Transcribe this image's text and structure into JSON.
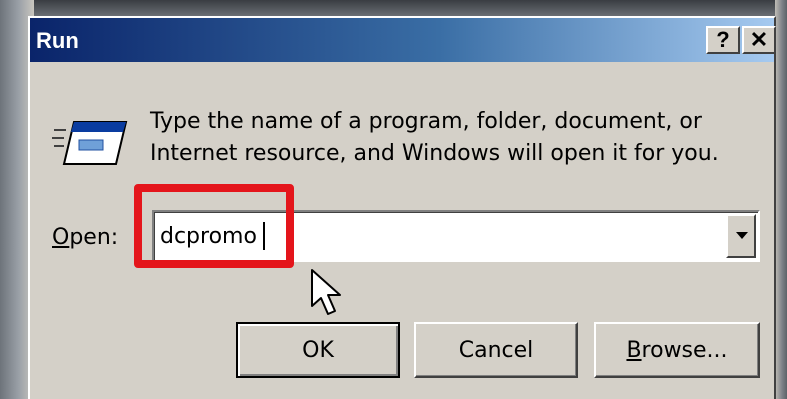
{
  "window": {
    "title": "Run",
    "help_label": "?",
    "close_label": "✕"
  },
  "description": {
    "line1": "Type the name of a program, folder, document, or",
    "line2": "Internet resource, and Windows will open it for you."
  },
  "open": {
    "label_accel": "O",
    "label_rest": "pen:",
    "value": "dcpromo"
  },
  "buttons": {
    "ok": "OK",
    "cancel": "Cancel",
    "browse_accel": "B",
    "browse_rest": "rowse..."
  },
  "icons": {
    "run": "run-program-icon",
    "cursor": "mouse-pointer-icon",
    "dropdown": "chevron-down-icon"
  },
  "colors": {
    "titlebar_start": "#0a246a",
    "titlebar_end": "#a6caf0",
    "highlight": "#e4151b",
    "dialog_bg": "#d4d0c8"
  }
}
